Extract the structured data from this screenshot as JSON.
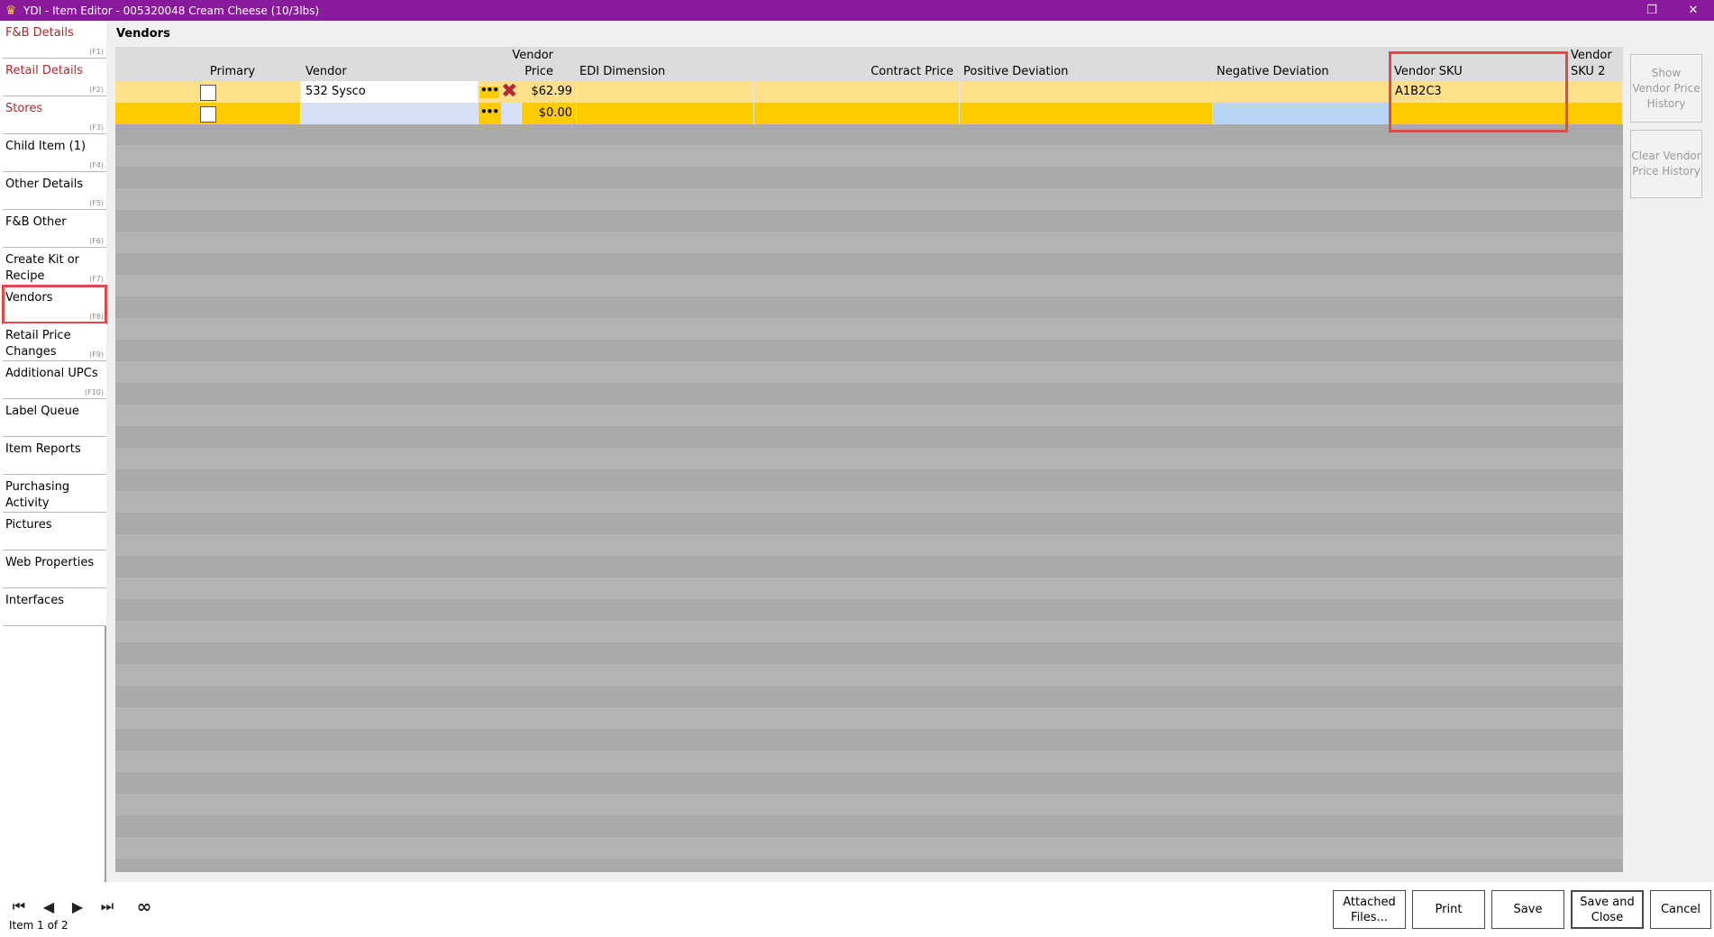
{
  "window": {
    "title": "YDI - Item Editor - 005320048 Cream Cheese (10/3lbs)",
    "restore_glyph": "❐",
    "close_glyph": "✕"
  },
  "nav": {
    "items": [
      {
        "label": "F&B Details",
        "fkey": "(F1)",
        "red": true
      },
      {
        "label": "Retail Details",
        "fkey": "(F2)",
        "red": true
      },
      {
        "label": "Stores",
        "fkey": "(F3)",
        "red": true
      },
      {
        "label": "Child Item (1)",
        "fkey": "(F4)"
      },
      {
        "label": "Other Details",
        "fkey": "(F5)"
      },
      {
        "label": "F&B Other",
        "fkey": "(F6)"
      },
      {
        "label": "Create Kit or Recipe",
        "fkey": "(F7)"
      },
      {
        "label": "Vendors",
        "fkey": "(F8)",
        "highlight": true
      },
      {
        "label": "Retail Price Changes",
        "fkey": "(F9)"
      },
      {
        "label": "Additional UPCs",
        "fkey": "(F10)"
      },
      {
        "label": "Label Queue",
        "fkey": ""
      },
      {
        "label": "Item Reports",
        "fkey": ""
      },
      {
        "label": "Purchasing Activity",
        "fkey": ""
      },
      {
        "label": "Pictures",
        "fkey": ""
      },
      {
        "label": "Web Properties",
        "fkey": ""
      },
      {
        "label": "Interfaces",
        "fkey": ""
      }
    ]
  },
  "section_title": "Vendors",
  "grid": {
    "headers": {
      "primary": "Primary",
      "vendor": "Vendor",
      "vendor_price": "Vendor Price",
      "edi_dimension": "EDI Dimension",
      "contract_price": "Contract Price",
      "positive_deviation": "Positive Deviation",
      "negative_deviation": "Negative Deviation",
      "vendor_sku": "Vendor SKU",
      "vendor_sku2": "Vendor SKU 2"
    },
    "rows": [
      {
        "primary": false,
        "vendor": "532 Sysco",
        "price": "$62.99",
        "edi": "",
        "contract": "",
        "pos_dev": "",
        "neg_dev": "",
        "sku": "A1B2C3",
        "sku2": ""
      },
      {
        "primary": false,
        "vendor": "",
        "price": "$0.00",
        "edi": "",
        "contract": "",
        "pos_dev": "",
        "neg_dev": "",
        "sku": "",
        "sku2": ""
      }
    ],
    "lookup_glyph": "•••",
    "delete_glyph": "✖"
  },
  "side_buttons": {
    "show_history": "Show Vendor Price History",
    "clear_history": "Clear Vendor Price History"
  },
  "footer": {
    "counter": "Item 1 of 2",
    "first_glyph": "⏮",
    "prev_glyph": "◀",
    "next_glyph": "▶",
    "last_glyph": "⏭",
    "all_glyph": "∞",
    "attached_files": "Attached Files...",
    "print": "Print",
    "save": "Save",
    "save_and_close": "Save and Close",
    "cancel": "Cancel"
  },
  "colors": {
    "titlebar": "#8a1a9c",
    "row_selected": "#ffe08a",
    "row_new": "#ffcc00",
    "highlight_border": "#e04a4a"
  }
}
